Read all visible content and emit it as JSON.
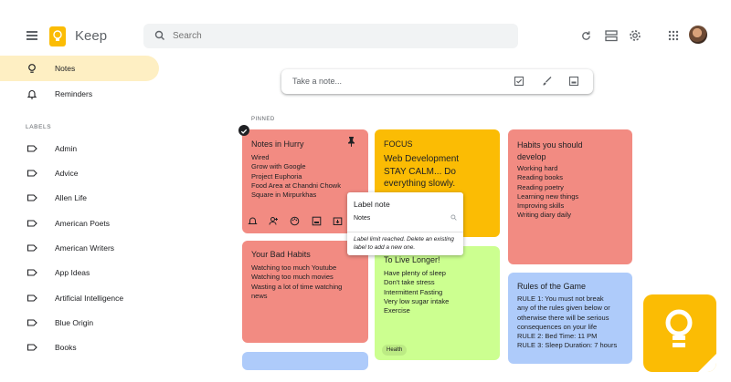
{
  "header": {
    "app_name": "Keep",
    "search_placeholder": "Search",
    "icons": [
      "menu-icon",
      "keep-logo-icon",
      "search-icon",
      "refresh-icon",
      "list-view-icon",
      "settings-icon",
      "apps-grid-icon",
      "avatar"
    ]
  },
  "sidebar": {
    "main_items": [
      {
        "label": "Notes",
        "icon": "lightbulb-icon",
        "active": true
      },
      {
        "label": "Reminders",
        "icon": "bell-icon"
      }
    ],
    "labels_heading": "LABELS",
    "label_items": [
      {
        "label": "Admin",
        "icon": "label-icon"
      },
      {
        "label": "Advice",
        "icon": "label-icon"
      },
      {
        "label": "Allen Life",
        "icon": "label-icon"
      },
      {
        "label": "American Poets",
        "icon": "label-icon"
      },
      {
        "label": "American Writers",
        "icon": "label-icon"
      },
      {
        "label": "App Ideas",
        "icon": "label-icon"
      },
      {
        "label": "Artificial Intelligence",
        "icon": "label-icon"
      },
      {
        "label": "Blue Origin",
        "icon": "label-icon"
      },
      {
        "label": "Books",
        "icon": "label-icon"
      }
    ]
  },
  "take_note": {
    "placeholder": "Take a note...",
    "icons": [
      "checkbox-icon",
      "brush-icon",
      "image-icon"
    ]
  },
  "pinned_label": "PINNED",
  "notes": {
    "hurry": {
      "title": "Notes in Hurry",
      "body": "Wired\nGrow with Google\nProject Euphoria\nFood Area at Chandni Chowk\nSquare in Mirpurkhas",
      "color": "#f28b82"
    },
    "focus": {
      "title": "FOCUS",
      "body": "Web Development\nSTAY CALM... Do\neverything slowly.",
      "color": "#fbbc04"
    },
    "habits_develop": {
      "title": "Habits you should\ndevelop",
      "body": "Working hard\nReading books\nReading poetry\nLearning new things\nImproving skills\nWriting diary daily",
      "color": "#f28b82"
    },
    "bad_habits": {
      "title": "Your Bad Habits",
      "body": "Watching too much Youtube\nWatching too much movies\nWasting a lot of time watching\nnews",
      "color": "#f28b82"
    },
    "live_longer": {
      "title": "To Live Longer!",
      "body": "Have plenty of sleep\nDon't take stress\nIntermittent Fasting\nVery low sugar intake\nExercise",
      "chip": "Health",
      "color": "#ccff90"
    },
    "rules": {
      "title": "Rules of the Game",
      "body": "RULE 1: You must not break\nany of the rules given below or\notherwise there will be serious\nconsequences on your life\nRULE 2: Bed Time: 11 PM\nRULE 3: Sleep Duration: 7 hours",
      "color": "#aecbfa"
    }
  },
  "label_popup": {
    "title": "Label note",
    "input_value": "Notes",
    "message": "Label limit reached. Delete an existing label to add a new one."
  }
}
